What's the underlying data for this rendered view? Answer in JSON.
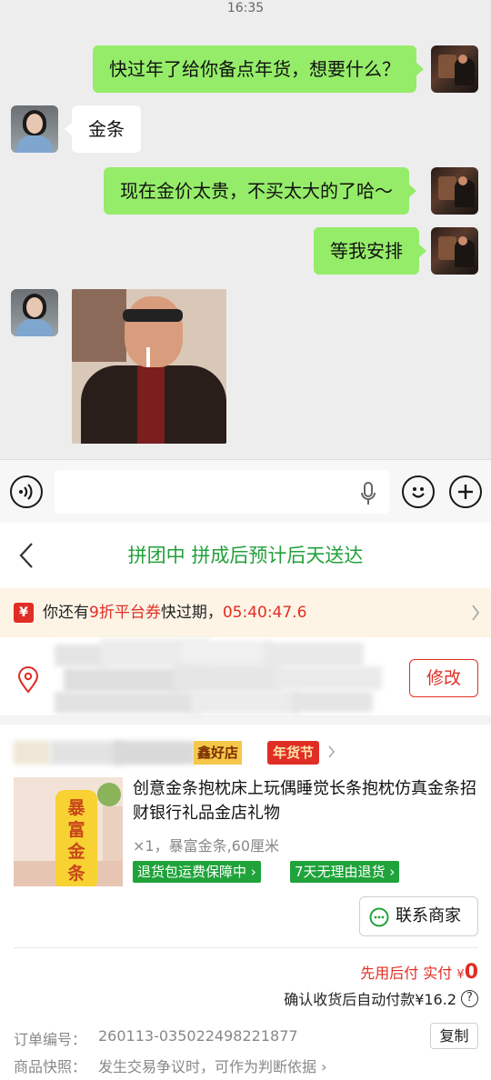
{
  "status_bar": {
    "time": "16:35"
  },
  "chat": {
    "messages": [
      {
        "side": "right",
        "type": "text",
        "text": "快过年了给你备点年货，想要什么？"
      },
      {
        "side": "left",
        "type": "text",
        "text": "金条"
      },
      {
        "side": "right",
        "type": "text",
        "text": "现在金价太贵，不买太大的了哈～"
      },
      {
        "side": "right",
        "type": "text",
        "text": "等我安排"
      },
      {
        "side": "left",
        "type": "sticker"
      }
    ]
  },
  "input_bar": {
    "voice_icon": "voice-icon",
    "mic_icon": "microphone-icon",
    "emoji_icon": "emoji-icon",
    "plus_icon": "plus-icon"
  },
  "order": {
    "header": {
      "title": "拼团中 拼成后预计后天送达"
    },
    "coupon": {
      "badge": "¥",
      "prefix": "你还有",
      "highlight": "9折平台券",
      "suffix": "快过期，",
      "countdown": "05:40:47.6"
    },
    "address": {
      "edit_label": "修改"
    },
    "shop": {
      "name_tag": "鑫好店",
      "festival_tag": "年货节"
    },
    "product": {
      "image_chars": [
        "暴",
        "富",
        "金",
        "条"
      ],
      "title": "创意金条抱枕床上玩偶睡觉长条抱枕仿真金条招财银行礼品金店礼物",
      "spec": "×1，暴富金条,60厘米",
      "tags": [
        "退货包运费保障中",
        "7天无理由退货"
      ]
    },
    "contact_label": "联系商家",
    "payment": {
      "label": "先用后付 实付",
      "currency": "¥",
      "amount": "0",
      "auto_pay": "确认收货后自动付款¥16.2"
    },
    "order_no": {
      "label": "订单编号：",
      "value": "260113-035022498221877",
      "copy_label": "复制"
    },
    "snapshot": {
      "label": "商品快照：",
      "value": "发生交易争议时，可作为判断依据"
    }
  },
  "colors": {
    "chat_bg": "#ededed",
    "bubble_green": "#95ec69",
    "accent_green": "#22a03a",
    "accent_red": "#e02e24",
    "tag_green": "#1fa33a"
  }
}
